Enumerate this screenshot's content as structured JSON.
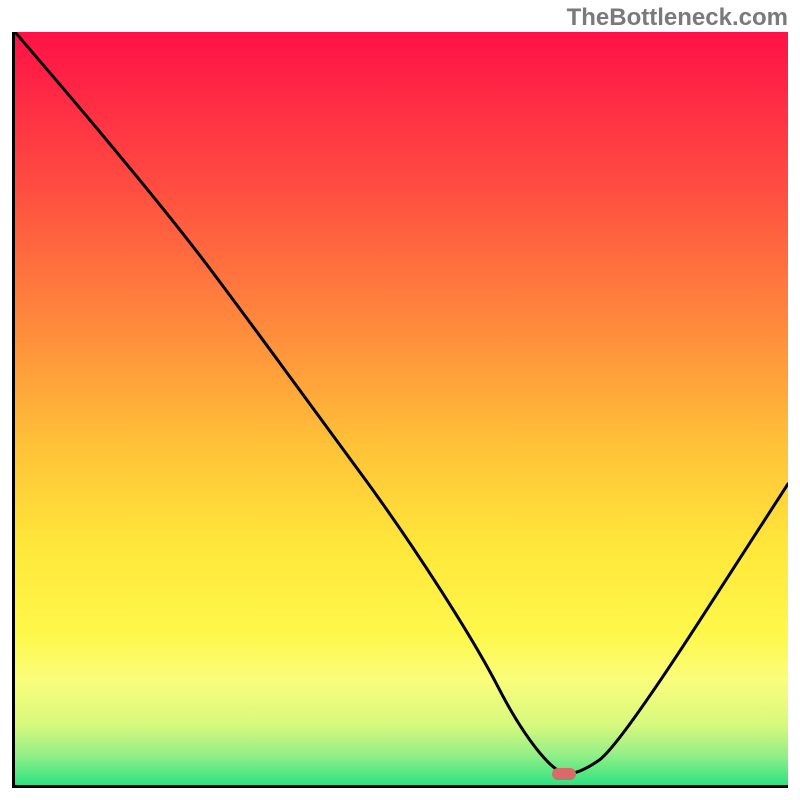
{
  "watermark": "TheBottleneck.com",
  "chart_data": {
    "type": "line",
    "title": "",
    "xlabel": "",
    "ylabel": "",
    "xlim": [
      0,
      100
    ],
    "ylim": [
      0,
      100
    ],
    "grid": false,
    "annotations": [
      {
        "type": "marker",
        "x": 71,
        "y": 1.5,
        "color": "#d86a6a"
      }
    ],
    "series": [
      {
        "name": "curve",
        "x": [
          0,
          10,
          22,
          30,
          40,
          50,
          60,
          65,
          70,
          73,
          78,
          100
        ],
        "y": [
          100,
          88,
          73,
          62,
          48,
          34,
          18,
          8,
          1.5,
          1.5,
          5,
          40
        ],
        "color": "#000000"
      }
    ],
    "background_gradient": {
      "stops": [
        {
          "offset": 0.0,
          "color": "#ff1147"
        },
        {
          "offset": 0.2,
          "color": "#ff4b41"
        },
        {
          "offset": 0.4,
          "color": "#ff8d3c"
        },
        {
          "offset": 0.55,
          "color": "#ffc238"
        },
        {
          "offset": 0.68,
          "color": "#ffe63a"
        },
        {
          "offset": 0.8,
          "color": "#fef84a"
        },
        {
          "offset": 0.86,
          "color": "#fbfd7c"
        },
        {
          "offset": 0.92,
          "color": "#d7f97e"
        },
        {
          "offset": 0.96,
          "color": "#94ef87"
        },
        {
          "offset": 1.0,
          "color": "#2de381"
        }
      ]
    }
  }
}
